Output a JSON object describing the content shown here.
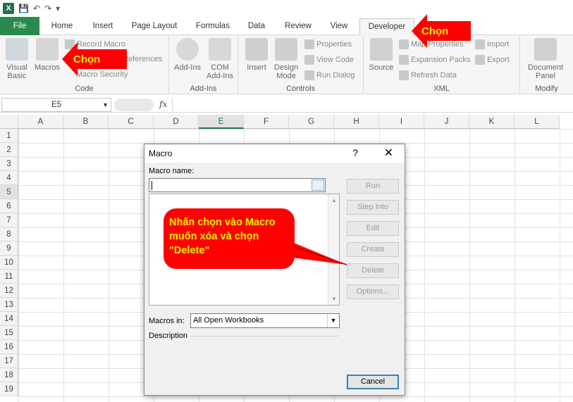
{
  "tabs": [
    "File",
    "Home",
    "Insert",
    "Page Layout",
    "Formulas",
    "Data",
    "Review",
    "View",
    "Developer"
  ],
  "ribbon": {
    "code": {
      "label": "Code",
      "visual_basic": "Visual Basic",
      "macros": "Macros",
      "record_macro": "Record Macro",
      "references": "References",
      "macro_security": "Macro Security"
    },
    "addins": {
      "label": "Add-Ins",
      "addins": "Add-Ins",
      "com_addins": "COM Add-Ins"
    },
    "controls": {
      "label": "Controls",
      "insert": "Insert",
      "design_mode": "Design Mode",
      "properties": "Properties",
      "view_code": "View Code",
      "run_dialog": "Run Dialog"
    },
    "xml": {
      "label": "XML",
      "source": "Source",
      "map_properties": "Map Properties",
      "expansion_packs": "Expansion Packs",
      "refresh_data": "Refresh Data",
      "import": "Import",
      "export": "Export"
    },
    "modify": {
      "label": "Modify",
      "document_panel": "Document Panel"
    }
  },
  "formula_bar": {
    "name_box": "E5",
    "fx": "fx"
  },
  "columns": [
    "A",
    "B",
    "C",
    "D",
    "E",
    "F",
    "G",
    "H",
    "I",
    "J",
    "K",
    "L"
  ],
  "rows": [
    "1",
    "2",
    "3",
    "4",
    "5",
    "6",
    "7",
    "8",
    "9",
    "10",
    "11",
    "12",
    "13",
    "14",
    "15",
    "16",
    "17",
    "18",
    "19"
  ],
  "selected_cell": {
    "col": "E",
    "row": "5"
  },
  "dialog": {
    "title": "Macro",
    "help": "?",
    "close": "✕",
    "macro_name_label": "Macro name:",
    "macro_name_value": "",
    "buttons": {
      "run": "Run",
      "step_into": "Step Into",
      "edit": "Edit",
      "create": "Create",
      "delete": "Delete",
      "options": "Options...",
      "cancel": "Cancel"
    },
    "macros_in_label": "Macros in:",
    "macros_in_value": "All Open Workbooks",
    "description_label": "Description"
  },
  "annotations": {
    "chon_1": "Chọn",
    "chon_2": "Chọn",
    "bubble": "Nhấn chọn vào Macro muốn xóa và chọn \"Delete\""
  },
  "colors": {
    "file_tab": "#2a8a4d",
    "callout_bg": "#ff0000",
    "callout_text": "#fff200",
    "excel_green": "#217346"
  }
}
